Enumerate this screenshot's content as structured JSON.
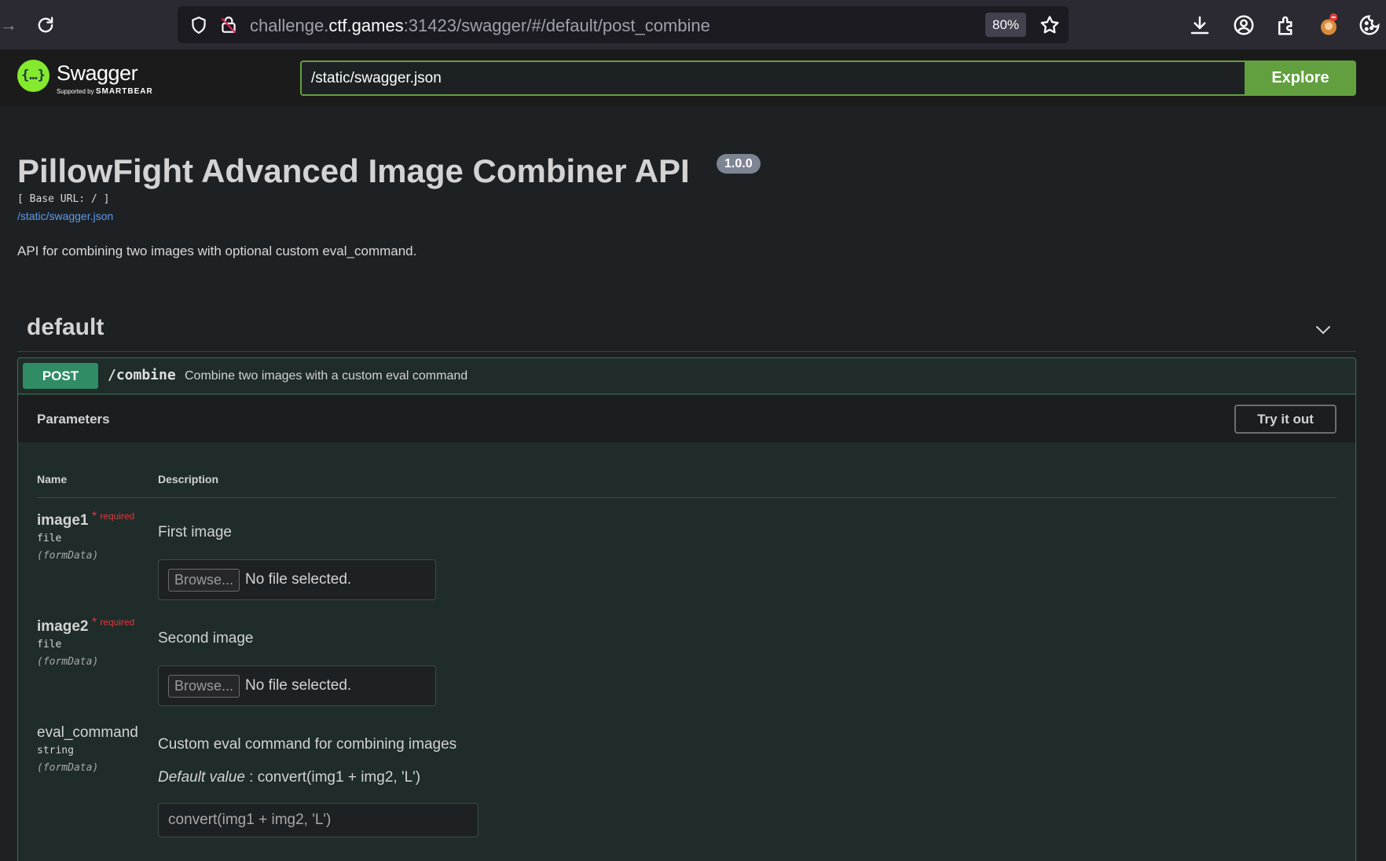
{
  "browser": {
    "url_prefix": "challenge.",
    "url_host": "ctf.games",
    "url_suffix": ":31423/swagger/#/default/post_combine",
    "zoom": "80%"
  },
  "topbar": {
    "logo_name": "Swagger",
    "logo_supported": "Supported by",
    "logo_brand": "SMARTBEAR",
    "spec_url": "/static/swagger.json",
    "explore_label": "Explore"
  },
  "info": {
    "title": "PillowFight Advanced Image Combiner API",
    "version": "1.0.0",
    "base_url": "[ Base URL: / ]",
    "spec_link": "/static/swagger.json",
    "description": "API for combining two images with optional custom eval_command."
  },
  "tag": {
    "name": "default"
  },
  "operation": {
    "method": "POST",
    "path": "/combine",
    "summary": "Combine two images with a custom eval command",
    "params_title": "Parameters",
    "try_label": "Try it out",
    "col_name": "Name",
    "col_description": "Description",
    "params": [
      {
        "name": "image1",
        "required": "required",
        "type": "file",
        "in": "(formData)",
        "description": "First image",
        "browse_label": "Browse...",
        "file_status": "No file selected."
      },
      {
        "name": "image2",
        "required": "required",
        "type": "file",
        "in": "(formData)",
        "description": "Second image",
        "browse_label": "Browse...",
        "file_status": "No file selected."
      },
      {
        "name": "eval_command",
        "type": "string",
        "in": "(formData)",
        "description": "Custom eval command for combining images",
        "default_label": "Default value",
        "default_value": " : convert(img1 + img2, 'L')",
        "input_value": "convert(img1 + img2, 'L')"
      }
    ]
  },
  "colors": {
    "accent_green": "#62a03f",
    "post_green": "#2f8c64",
    "required_red": "#e0383f",
    "link_blue": "#5d9cec"
  }
}
